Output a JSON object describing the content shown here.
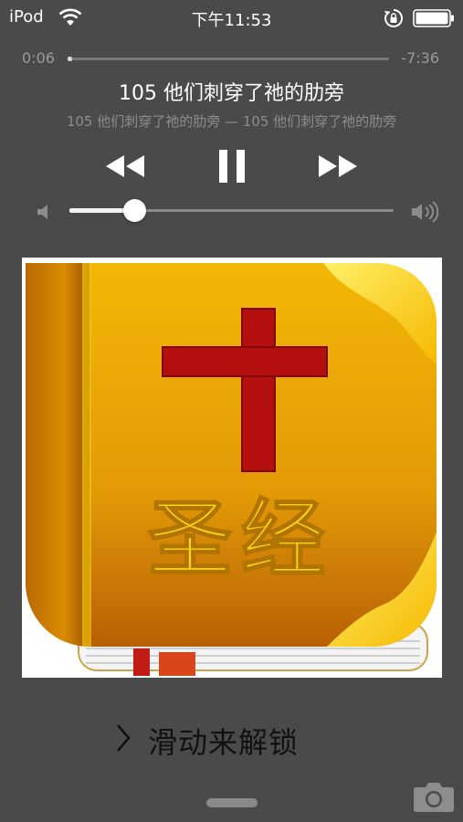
{
  "status_bar": {
    "carrier": "iPod",
    "time": "下午11:53",
    "icons": [
      "wifi-icon",
      "rotation-lock-icon",
      "battery-icon"
    ]
  },
  "playback": {
    "elapsed": "0:06",
    "remaining": "-7:36",
    "progress_fraction": 0.013
  },
  "track": {
    "title": "105 他们刺穿了祂的肋旁",
    "subtitle": "105 他们刺穿了祂的肋旁 — 105 他们刺穿了祂的肋旁"
  },
  "controls": {
    "icons": [
      "rewind-icon",
      "pause-icon",
      "fast-forward-icon"
    ]
  },
  "volume": {
    "level_fraction": 0.2,
    "icons": [
      "volume-low-icon",
      "volume-high-icon"
    ]
  },
  "artwork": {
    "title_glyphs": "圣经",
    "icon": "bible-cross-icon",
    "colors": {
      "cover": "#e0a300",
      "cross": "#b30f0f",
      "text": "#ffd21a"
    }
  },
  "unlock": {
    "label": "滑动来解锁"
  },
  "camera": {
    "icon": "camera-icon"
  },
  "colors": {
    "background": "#4a4a4a",
    "muted_text": "#9a9a9a"
  }
}
